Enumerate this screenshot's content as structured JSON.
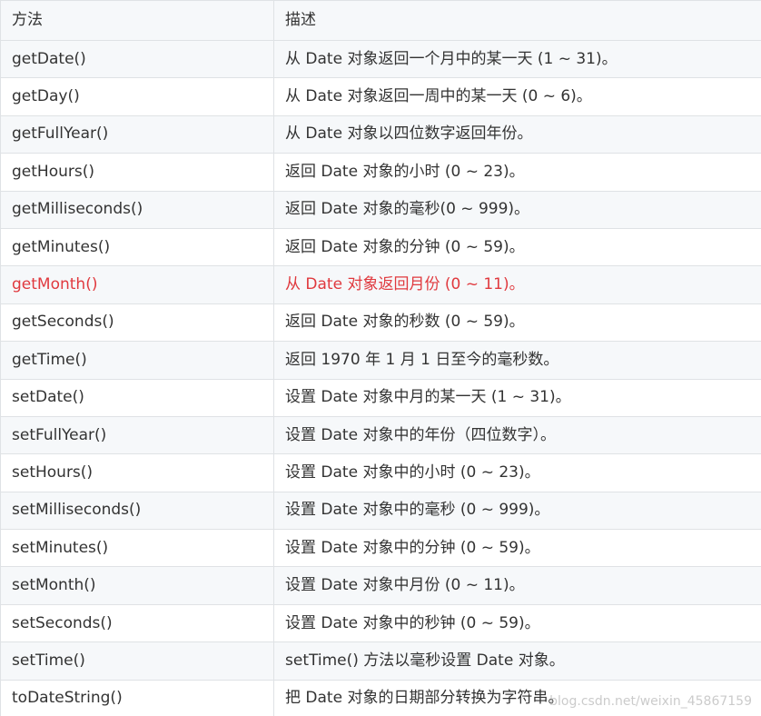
{
  "table": {
    "headers": [
      "方法",
      "描述"
    ],
    "rows": [
      {
        "method": "getDate()",
        "desc": "从 Date 对象返回一个月中的某一天 (1 ~ 31)。"
      },
      {
        "method": "getDay()",
        "desc": "从 Date 对象返回一周中的某一天 (0 ~ 6)。"
      },
      {
        "method": "getFullYear()",
        "desc": "从 Date 对象以四位数字返回年份。"
      },
      {
        "method": "getHours()",
        "desc": "返回 Date 对象的小时 (0 ~ 23)。"
      },
      {
        "method": "getMilliseconds()",
        "desc": "返回 Date 对象的毫秒(0 ~ 999)。"
      },
      {
        "method": "getMinutes()",
        "desc": "返回 Date 对象的分钟 (0 ~ 59)。"
      },
      {
        "method": "getMonth()",
        "desc": "从 Date 对象返回月份 (0 ~ 11)。",
        "highlight": true
      },
      {
        "method": "getSeconds()",
        "desc": "返回 Date 对象的秒数 (0 ~ 59)。"
      },
      {
        "method": "getTime()",
        "desc": "返回 1970 年 1 月 1 日至今的毫秒数。"
      },
      {
        "method": "setDate()",
        "desc": "设置 Date 对象中月的某一天 (1 ~ 31)。"
      },
      {
        "method": "setFullYear()",
        "desc": "设置 Date 对象中的年份（四位数字）。"
      },
      {
        "method": "setHours()",
        "desc": "设置 Date 对象中的小时 (0 ~ 23)。"
      },
      {
        "method": "setMilliseconds()",
        "desc": "设置 Date 对象中的毫秒 (0 ~ 999)。"
      },
      {
        "method": "setMinutes()",
        "desc": "设置 Date 对象中的分钟 (0 ~ 59)。"
      },
      {
        "method": "setMonth()",
        "desc": "设置 Date 对象中月份 (0 ~ 11)。"
      },
      {
        "method": "setSeconds()",
        "desc": "设置 Date 对象中的秒钟 (0 ~ 59)。"
      },
      {
        "method": "setTime()",
        "desc": "setTime() 方法以毫秒设置 Date 对象。"
      },
      {
        "method": "toDateString()",
        "desc": "把 Date 对象的日期部分转换为字符串。"
      }
    ]
  },
  "colors": {
    "highlight_text": "#e0393e",
    "border": "#dfe2e5",
    "stripe": "#f6f8fa"
  },
  "watermark": "blog.csdn.net/weixin_45867159"
}
